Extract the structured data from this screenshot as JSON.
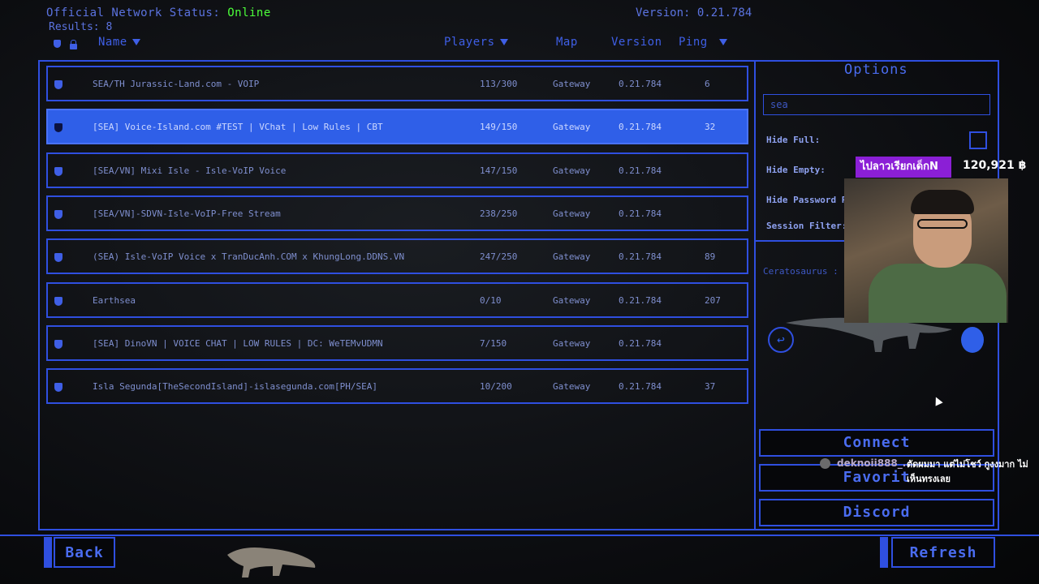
{
  "header": {
    "status_label": "Official Network Status: ",
    "status_value": "Online",
    "results_label": "Results: 8",
    "version_label": "Version: 0.21.784"
  },
  "columns": {
    "name": "Name",
    "players": "Players",
    "map": "Map",
    "version": "Version",
    "ping": "Ping"
  },
  "servers": [
    {
      "name": "SEA/TH Jurassic-Land.com - VOIP",
      "players": "113/300",
      "map": "Gateway",
      "version": "0.21.784",
      "ping": "6"
    },
    {
      "name": "[SEA] Voice-Island.com #TEST | VChat | Low Rules | CBT",
      "players": "149/150",
      "map": "Gateway",
      "version": "0.21.784",
      "ping": "32"
    },
    {
      "name": "[SEA/VN] Mixi Isle - Isle-VoIP Voice",
      "players": "147/150",
      "map": "Gateway",
      "version": "0.21.784",
      "ping": ""
    },
    {
      "name": "[SEA/VN]-SDVN-Isle-VoIP-Free Stream",
      "players": "238/250",
      "map": "Gateway",
      "version": "0.21.784",
      "ping": ""
    },
    {
      "name": "(SEA) Isle-VoIP Voice x TranDucAnh.COM x KhungLong.DDNS.VN",
      "players": "247/250",
      "map": "Gateway",
      "version": "0.21.784",
      "ping": "89"
    },
    {
      "name": "Earthsea",
      "players": "0/10",
      "map": "Gateway",
      "version": "0.21.784",
      "ping": "207"
    },
    {
      "name": "[SEA] DinoVN | VOICE CHAT | LOW RULES | DC: WeTEMvUDMN",
      "players": "7/150",
      "map": "Gateway",
      "version": "0.21.784",
      "ping": ""
    },
    {
      "name": "Isla Segunda[TheSecondIsland]-islasegunda.com[PH/SEA]",
      "players": "10/200",
      "map": "Gateway",
      "version": "0.21.784",
      "ping": "37"
    }
  ],
  "selected_index": 1,
  "options": {
    "title": "Options",
    "search_value": "sea",
    "hide_full": "Hide Full:",
    "hide_empty": "Hide Empty:",
    "hide_password": "Hide Password P",
    "session_filter": "Session Filter:",
    "dino_label": "Ceratosaurus :"
  },
  "buttons": {
    "connect": "Connect",
    "favorite": "Favorit",
    "discord": "Discord",
    "back": "Back",
    "refresh": "Refresh"
  },
  "stream_overlay": {
    "banner": "ไปลาวเรียกเด็กN",
    "amount": "120,921 ฿",
    "chat_user": "deknoii888_..",
    "chat_message": "ตัดผมมา แต่ไม่โชว์ กูงงมาก ไม่เห็นทรงเลย"
  },
  "colors": {
    "accent": "#2f4fe0",
    "selected_row": "#2f5fe8",
    "online": "#4cff3a"
  }
}
